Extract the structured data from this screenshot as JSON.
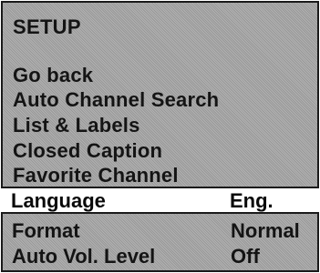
{
  "menu": {
    "title": "SETUP",
    "items": [
      {
        "label": "Go back"
      },
      {
        "label": "Auto Channel Search"
      },
      {
        "label": "List & Labels"
      },
      {
        "label": "Closed Caption"
      },
      {
        "label": "Favorite Channel"
      }
    ],
    "selected": {
      "label": "Language",
      "value": "Eng."
    },
    "settings": [
      {
        "label": "Format",
        "value": "Normal"
      },
      {
        "label": "Auto Vol. Level",
        "value": "Off"
      }
    ]
  },
  "colors": {
    "panel": "#a9a9a9",
    "border": "#1a1a1a",
    "selected_row": "#ffffff",
    "text": "#141414"
  }
}
